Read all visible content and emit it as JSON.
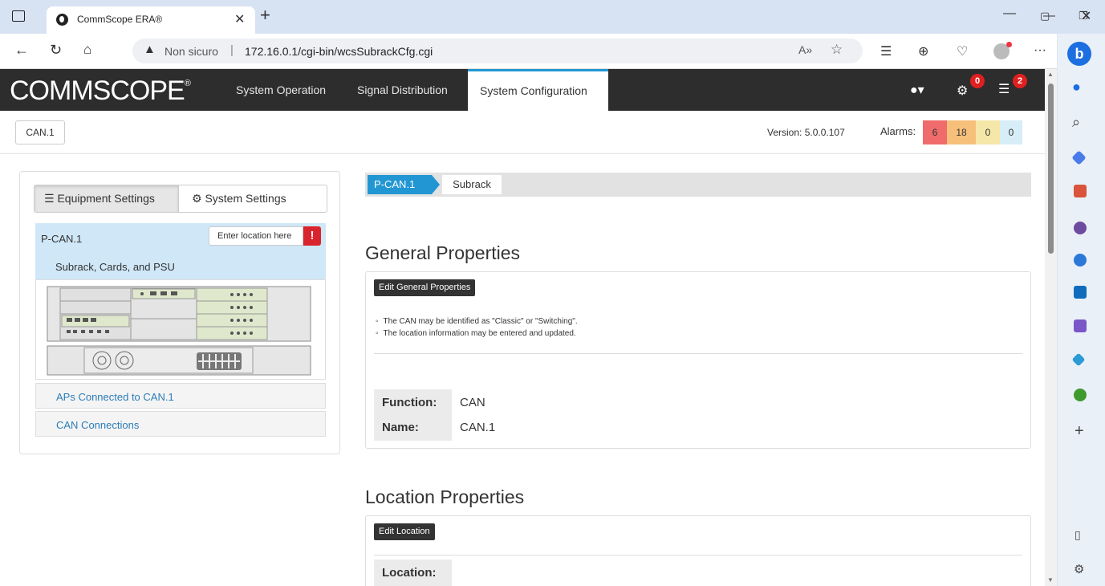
{
  "browser": {
    "tab_title": "CommScope ERA®",
    "insecure_label": "Non sicuro",
    "url": "172.16.0.1/cgi-bin/wcsSubrackCfg.cgi"
  },
  "app": {
    "logo": "COMMSCOPE",
    "logo_mark": "®",
    "nav": [
      "System Operation",
      "Signal Distribution",
      "System Configuration"
    ],
    "badges": {
      "settings": "0",
      "list": "2"
    }
  },
  "subheader": {
    "can_button": "CAN.1",
    "version_label": "Version:",
    "version_value": "5.0.0.107",
    "alarms_label": "Alarms:",
    "alarms": [
      {
        "value": "6",
        "color": "#f06b6b"
      },
      {
        "value": "18",
        "color": "#f7c07a"
      },
      {
        "value": "0",
        "color": "#f5e7a8"
      },
      {
        "value": "0",
        "color": "#d7eef8"
      }
    ]
  },
  "left": {
    "tab_equipment": "Equipment Settings",
    "tab_system": "System Settings",
    "p_can": "P-CAN.1",
    "location_placeholder": "Enter location here",
    "location_warn": "!",
    "subrack_row": "Subrack, Cards, and PSU",
    "aps_row": "APs Connected to CAN.1",
    "can_connections_row": "CAN Connections"
  },
  "content": {
    "crumb": [
      "P-CAN.1",
      "Subrack"
    ],
    "general_title": "General Properties",
    "edit_general": "Edit General Properties",
    "general_notes": [
      "The CAN may be identified as \"Classic\" or \"Switching\".",
      "The location information may be entered and updated."
    ],
    "function_label": "Function:",
    "function_value": "CAN",
    "name_label": "Name:",
    "name_value": "CAN.1",
    "location_title": "Location Properties",
    "edit_location": "Edit Location",
    "location_label": "Location:"
  }
}
